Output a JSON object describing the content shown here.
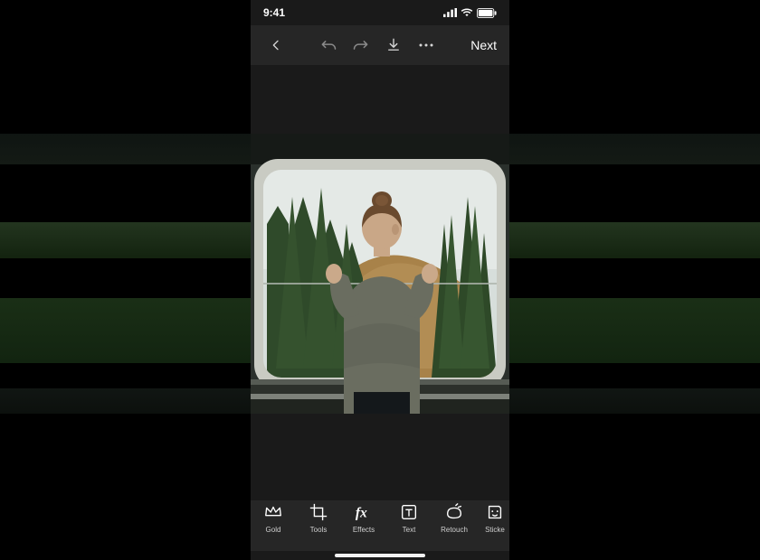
{
  "status": {
    "time": "9:41"
  },
  "topbar": {
    "next_label": "Next"
  },
  "tools": [
    {
      "key": "gold",
      "label": "Gold"
    },
    {
      "key": "tools",
      "label": "Tools"
    },
    {
      "key": "effects",
      "label": "Effects"
    },
    {
      "key": "text",
      "label": "Text"
    },
    {
      "key": "retouch",
      "label": "Retouch"
    },
    {
      "key": "sticker",
      "label": "Sticke"
    }
  ],
  "icons": {
    "back": "back-chevron",
    "undo": "undo-arrow",
    "redo": "redo-arrow",
    "download": "download-icon",
    "more": "ellipsis-icon"
  }
}
